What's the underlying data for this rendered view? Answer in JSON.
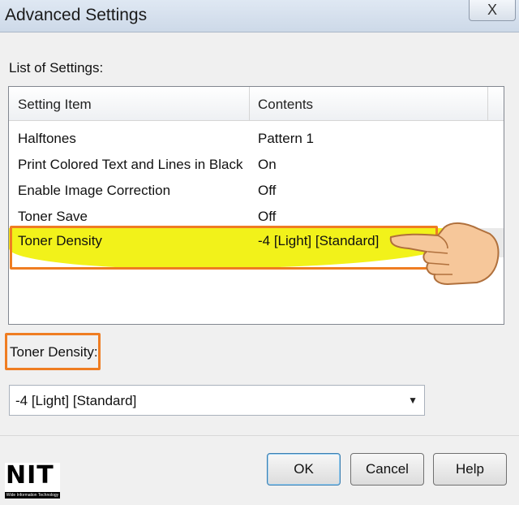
{
  "window": {
    "title": "Advanced Settings",
    "background_tabs": [
      "",
      "",
      ""
    ],
    "close_symbol": "X"
  },
  "list": {
    "label": "List of Settings:",
    "headers": [
      "Setting Item",
      "Contents"
    ],
    "rows": [
      {
        "item": "Halftones",
        "contents": "Pattern 1"
      },
      {
        "item": "Print Colored Text and Lines in Black",
        "contents": "On"
      },
      {
        "item": "Enable Image Correction",
        "contents": "Off"
      },
      {
        "item": "Toner Save",
        "contents": "Off"
      },
      {
        "item": "Toner Density",
        "contents": "-4 [Light] [Standard]"
      }
    ],
    "selected_index": 4
  },
  "detail": {
    "label": "Toner Density:",
    "value": "-4 [Light] [Standard]"
  },
  "buttons": {
    "ok": "OK",
    "cancel": "Cancel",
    "help": "Help"
  },
  "logo": {
    "text": "NIT",
    "subtitle": "Wide Information Technology"
  },
  "colors": {
    "highlight": "#f2f21a",
    "callout": "#ef7d22"
  },
  "icons": {
    "pointer": "pointing-hand-icon",
    "dropdown": "chevron-down-icon"
  }
}
